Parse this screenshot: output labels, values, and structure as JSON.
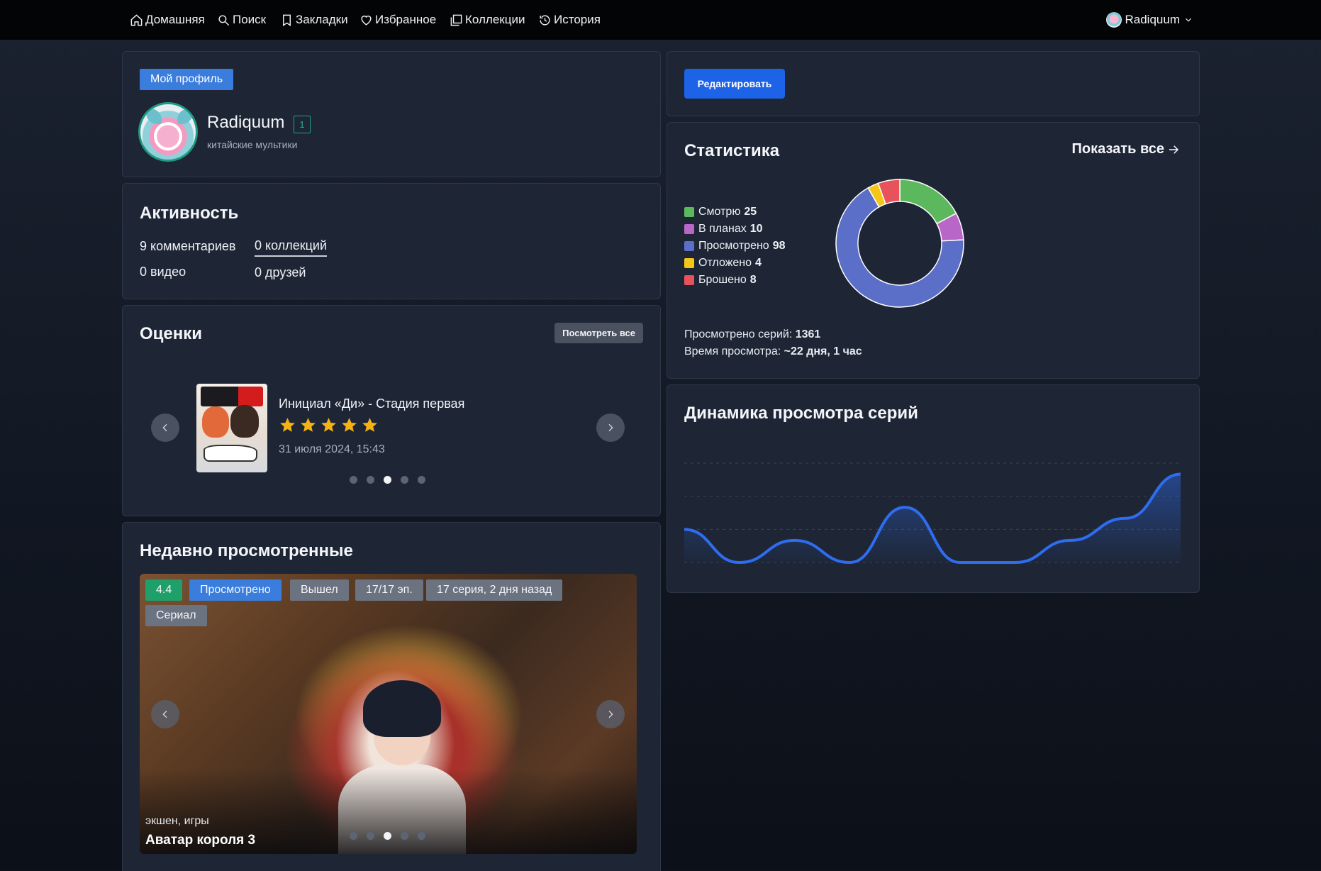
{
  "nav": {
    "items": [
      {
        "label": "Домашняя",
        "icon": "home-icon"
      },
      {
        "label": "Поиск",
        "icon": "search-icon"
      },
      {
        "label": "Закладки",
        "icon": "bookmark-icon"
      },
      {
        "label": "Избранное",
        "icon": "heart-icon"
      },
      {
        "label": "Коллекции",
        "icon": "collections-icon"
      },
      {
        "label": "История",
        "icon": "history-icon"
      }
    ],
    "user": "Radiquum"
  },
  "profile": {
    "badge": "Мой профиль",
    "username": "Radiquum",
    "level": "1",
    "status": "китайские мультики"
  },
  "edit_button": "Редактировать",
  "activity": {
    "title": "Активность",
    "comments": "9 комментариев",
    "collections": "0 коллекций",
    "videos": "0 видео",
    "friends": "0 друзей"
  },
  "ratings": {
    "title": "Оценки",
    "view_all": "Посмотреть все",
    "item_title": "Инициал «Ди» - Стадия первая",
    "stars": 5,
    "date": "31 июля 2024, 15:43",
    "slide_count": 5,
    "active_slide": 3
  },
  "recent": {
    "title": "Недавно просмотренные",
    "tags_row1": [
      "4.4",
      "Просмотрено",
      "Вышел",
      "17/17 эп.",
      "17 серия, 2 дня назад"
    ],
    "tags_row2": [
      "Сериал"
    ],
    "genres": "экшен, игры",
    "show_name": "Аватар короля 3",
    "slide_count": 5,
    "active_slide": 3
  },
  "stats": {
    "title": "Статистика",
    "show_all": "Показать все",
    "categories": [
      {
        "label": "Смотрю",
        "value": 25,
        "color": "#5cb85c"
      },
      {
        "label": "В планах",
        "value": 10,
        "color": "#b966c9"
      },
      {
        "label": "Просмотрено",
        "value": 98,
        "color": "#5b6fc9"
      },
      {
        "label": "Отложено",
        "value": 4,
        "color": "#f5c518"
      },
      {
        "label": "Брошено",
        "value": 8,
        "color": "#e8525a"
      }
    ],
    "episodes_label": "Просмотрено серий:",
    "episodes_value": "1361",
    "time_label": "Время просмотра:",
    "time_value": "~22 дня, 1 час"
  },
  "dynamics": {
    "title": "Динамика просмотра серий"
  },
  "chart_data": {
    "type": "area",
    "title": "Динамика просмотра серий",
    "values": [
      3,
      0,
      2,
      0,
      5,
      0,
      0,
      2,
      4,
      8
    ],
    "ylim": [
      0,
      9
    ],
    "color": "#2f6df0",
    "grid": true
  }
}
